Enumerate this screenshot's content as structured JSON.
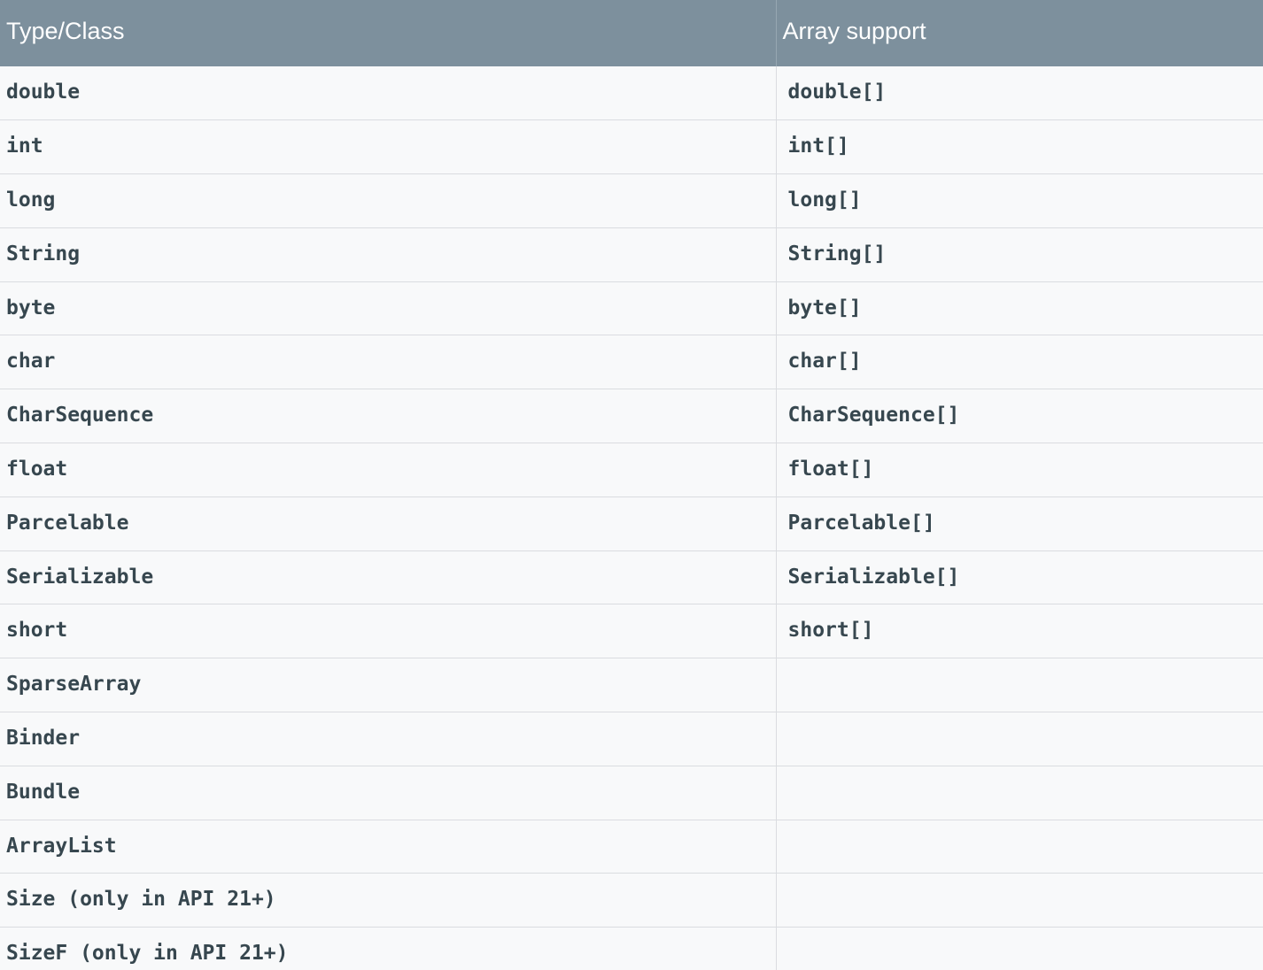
{
  "table": {
    "headers": [
      "Type/Class",
      "Array support"
    ],
    "rows": [
      [
        "double",
        "double[]"
      ],
      [
        "int",
        "int[]"
      ],
      [
        "long",
        "long[]"
      ],
      [
        "String",
        "String[]"
      ],
      [
        "byte",
        "byte[]"
      ],
      [
        "char",
        "char[]"
      ],
      [
        "CharSequence",
        "CharSequence[]"
      ],
      [
        "float",
        "float[]"
      ],
      [
        "Parcelable",
        "Parcelable[]"
      ],
      [
        "Serializable",
        "Serializable[]"
      ],
      [
        "short",
        "short[]"
      ],
      [
        "SparseArray",
        ""
      ],
      [
        "Binder",
        ""
      ],
      [
        "Bundle",
        ""
      ],
      [
        "ArrayList",
        ""
      ],
      [
        "Size (only in API 21+)",
        ""
      ],
      [
        "SizeF (only in API 21+)",
        ""
      ]
    ]
  }
}
